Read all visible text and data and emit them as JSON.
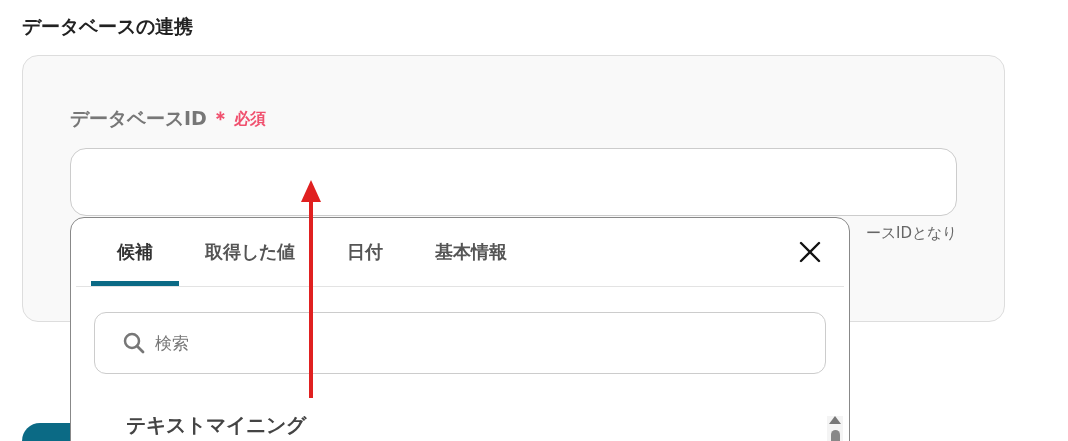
{
  "section_title": "データベースの連携",
  "field": {
    "label": "データベースID",
    "required_mark": "＊",
    "required": "必須",
    "hint": "ースIDとなり"
  },
  "popup": {
    "tabs": [
      {
        "label": "候補",
        "selected": true
      },
      {
        "label": "取得した値",
        "selected": false
      },
      {
        "label": "日付",
        "selected": false
      },
      {
        "label": "基本情報",
        "selected": false
      }
    ],
    "search": {
      "placeholder": "検索"
    },
    "groups": [
      {
        "title": "テキストマイニング"
      }
    ]
  }
}
